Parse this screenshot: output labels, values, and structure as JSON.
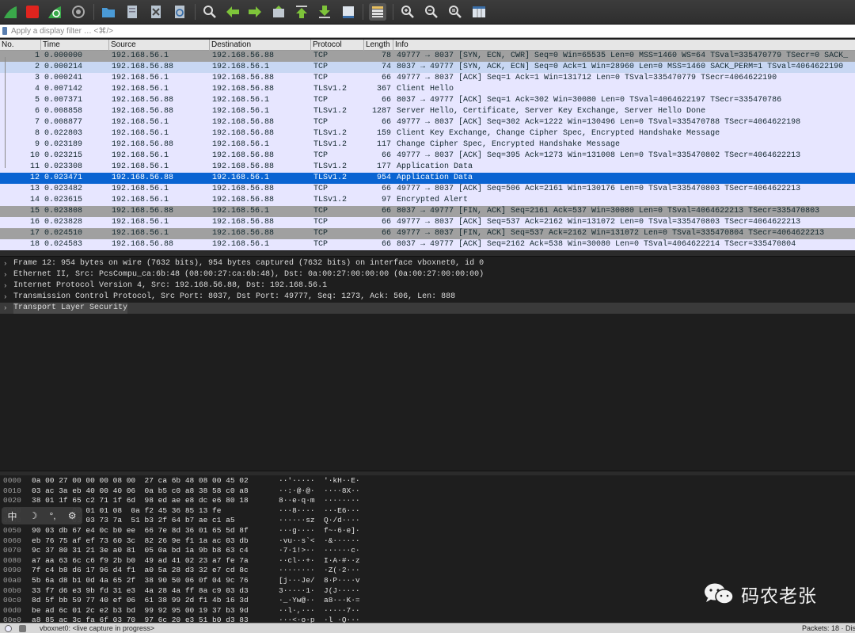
{
  "filter": {
    "placeholder": "Apply a display filter … <⌘/>"
  },
  "columns": {
    "no": "No.",
    "time": "Time",
    "source": "Source",
    "destination": "Destination",
    "protocol": "Protocol",
    "length": "Length",
    "info": "Info"
  },
  "packets": [
    {
      "no": "1",
      "time": "0.000000",
      "src": "192.168.56.1",
      "dst": "192.168.56.88",
      "proto": "TCP",
      "len": "78",
      "info": "49777 → 8037 [SYN, ECN, CWR] Seq=0 Win=65535 Len=0 MSS=1460 WS=64 TSval=335470779 TSecr=0 SACK_",
      "style": "gray"
    },
    {
      "no": "2",
      "time": "0.000214",
      "src": "192.168.56.88",
      "dst": "192.168.56.1",
      "proto": "TCP",
      "len": "74",
      "info": "8037 → 49777 [SYN, ACK, ECN] Seq=0 Ack=1 Win=28960 Len=0 MSS=1460 SACK_PERM=1 TSval=4064622190",
      "style": "lightblue"
    },
    {
      "no": "3",
      "time": "0.000241",
      "src": "192.168.56.1",
      "dst": "192.168.56.88",
      "proto": "TCP",
      "len": "66",
      "info": "49777 → 8037 [ACK] Seq=1 Ack=1 Win=131712 Len=0 TSval=335470779 TSecr=4064622190",
      "style": "lavender"
    },
    {
      "no": "4",
      "time": "0.007142",
      "src": "192.168.56.1",
      "dst": "192.168.56.88",
      "proto": "TLSv1.2",
      "len": "367",
      "info": "Client Hello",
      "style": "lavender"
    },
    {
      "no": "5",
      "time": "0.007371",
      "src": "192.168.56.88",
      "dst": "192.168.56.1",
      "proto": "TCP",
      "len": "66",
      "info": "8037 → 49777 [ACK] Seq=1 Ack=302 Win=30080 Len=0 TSval=4064622197 TSecr=335470786",
      "style": "lavender"
    },
    {
      "no": "6",
      "time": "0.008858",
      "src": "192.168.56.88",
      "dst": "192.168.56.1",
      "proto": "TLSv1.2",
      "len": "1287",
      "info": "Server Hello, Certificate, Server Key Exchange, Server Hello Done",
      "style": "lavender"
    },
    {
      "no": "7",
      "time": "0.008877",
      "src": "192.168.56.1",
      "dst": "192.168.56.88",
      "proto": "TCP",
      "len": "66",
      "info": "49777 → 8037 [ACK] Seq=302 Ack=1222 Win=130496 Len=0 TSval=335470788 TSecr=4064622198",
      "style": "lavender"
    },
    {
      "no": "8",
      "time": "0.022803",
      "src": "192.168.56.1",
      "dst": "192.168.56.88",
      "proto": "TLSv1.2",
      "len": "159",
      "info": "Client Key Exchange, Change Cipher Spec, Encrypted Handshake Message",
      "style": "lavender"
    },
    {
      "no": "9",
      "time": "0.023189",
      "src": "192.168.56.88",
      "dst": "192.168.56.1",
      "proto": "TLSv1.2",
      "len": "117",
      "info": "Change Cipher Spec, Encrypted Handshake Message",
      "style": "lavender"
    },
    {
      "no": "10",
      "time": "0.023215",
      "src": "192.168.56.1",
      "dst": "192.168.56.88",
      "proto": "TCP",
      "len": "66",
      "info": "49777 → 8037 [ACK] Seq=395 Ack=1273 Win=131008 Len=0 TSval=335470802 TSecr=4064622213",
      "style": "lavender"
    },
    {
      "no": "11",
      "time": "0.023308",
      "src": "192.168.56.1",
      "dst": "192.168.56.88",
      "proto": "TLSv1.2",
      "len": "177",
      "info": "Application Data",
      "style": "lavender"
    },
    {
      "no": "12",
      "time": "0.023471",
      "src": "192.168.56.88",
      "dst": "192.168.56.1",
      "proto": "TLSv1.2",
      "len": "954",
      "info": "Application Data",
      "style": "selected"
    },
    {
      "no": "13",
      "time": "0.023482",
      "src": "192.168.56.1",
      "dst": "192.168.56.88",
      "proto": "TCP",
      "len": "66",
      "info": "49777 → 8037 [ACK] Seq=506 Ack=2161 Win=130176 Len=0 TSval=335470803 TSecr=4064622213",
      "style": "lavender"
    },
    {
      "no": "14",
      "time": "0.023615",
      "src": "192.168.56.1",
      "dst": "192.168.56.88",
      "proto": "TLSv1.2",
      "len": "97",
      "info": "Encrypted Alert",
      "style": "lavender"
    },
    {
      "no": "15",
      "time": "0.023808",
      "src": "192.168.56.88",
      "dst": "192.168.56.1",
      "proto": "TCP",
      "len": "66",
      "info": "8037 → 49777 [FIN, ACK] Seq=2161 Ack=537 Win=30080 Len=0 TSval=4064622213 TSecr=335470803",
      "style": "gray"
    },
    {
      "no": "16",
      "time": "0.023828",
      "src": "192.168.56.1",
      "dst": "192.168.56.88",
      "proto": "TCP",
      "len": "66",
      "info": "49777 → 8037 [ACK] Seq=537 Ack=2162 Win=131072 Len=0 TSval=335470803 TSecr=4064622213",
      "style": "lavender"
    },
    {
      "no": "17",
      "time": "0.024510",
      "src": "192.168.56.1",
      "dst": "192.168.56.88",
      "proto": "TCP",
      "len": "66",
      "info": "49777 → 8037 [FIN, ACK] Seq=537 Ack=2162 Win=131072 Len=0 TSval=335470804 TSecr=4064622213",
      "style": "gray"
    },
    {
      "no": "18",
      "time": "0.024583",
      "src": "192.168.56.88",
      "dst": "192.168.56.1",
      "proto": "TCP",
      "len": "66",
      "info": "8037 → 49777 [ACK] Seq=2162 Ack=538 Win=30080 Len=0 TSval=4064622214 TSecr=335470804",
      "style": "lavender"
    }
  ],
  "row_colors": {
    "gray": "#a0a0a0",
    "lightblue": "#c8d7f3",
    "lavender": "#e7e6ff",
    "selected": "#0a64d2",
    "text": "#12272e",
    "selected_text": "#ffffff"
  },
  "details": [
    {
      "expanded": false,
      "text": "Frame 12: 954 bytes on wire (7632 bits), 954 bytes captured (7632 bits) on interface vboxnet0, id 0"
    },
    {
      "expanded": false,
      "text": "Ethernet II, Src: PcsCompu_ca:6b:48 (08:00:27:ca:6b:48), Dst: 0a:00:27:00:00:00 (0a:00:27:00:00:00)"
    },
    {
      "expanded": false,
      "text": "Internet Protocol Version 4, Src: 192.168.56.88, Dst: 192.168.56.1"
    },
    {
      "expanded": false,
      "text": "Transmission Control Protocol, Src Port: 8037, Dst Port: 49777, Seq: 1273, Ack: 506, Len: 888"
    },
    {
      "expanded": false,
      "text": "Transport Layer Security",
      "highlighted": true
    }
  ],
  "hex": [
    {
      "off": "0000",
      "hex": "0a 00 27 00 00 00 08 00  27 ca 6b 48 08 00 45 02",
      "ascii": "··'·····  '·kH··E·"
    },
    {
      "off": "0010",
      "hex": "03 ac 3a eb 40 00 40 06  0a b5 c0 a8 38 58 c0 a8",
      "ascii": "··:·@·@·  ····8X··"
    },
    {
      "off": "0020",
      "hex": "38 01 1f 65 c2 71 1f 6d  98 ed ae e8 dc e6 80 18",
      "ascii": "8··e·q·m  ········"
    },
    {
      "off": "0030",
      "hex": "         00 01 01 08  0a f2 45 36 85 13 fe",
      "ascii": "···8····  ···E6···"
    },
    {
      "off": "0040",
      "hex": "         03 03 73 7a  51 b3 2f 64 b7 ae c1 a5",
      "ascii": "······sz  Q·/d····"
    },
    {
      "off": "0050",
      "hex": "90 03 db 67 e4 0c b0 ee  66 7e 8d 36 01 65 5d 8f",
      "ascii": "···g····  f~·6·e]·"
    },
    {
      "off": "0060",
      "hex": "eb 76 75 af ef 73 60 3c  82 26 9e f1 1a ac 03 db",
      "ascii": "·vu··s`<  ·&······"
    },
    {
      "off": "0070",
      "hex": "9c 37 80 31 21 3e a0 81  05 0a bd 1a 9b b8 63 c4",
      "ascii": "·7·1!>··  ······c·"
    },
    {
      "off": "0080",
      "hex": "a7 aa 63 6c c6 f9 2b b0  49 ad 41 02 23 a7 fe 7a",
      "ascii": "··cl··+·  I·A·#··z"
    },
    {
      "off": "0090",
      "hex": "7f c4 b8 d6 17 96 d4 f1  a0 5a 28 d3 32 e7 cd 8c",
      "ascii": "········  ·Z(·2···"
    },
    {
      "off": "00a0",
      "hex": "5b 6a d8 b1 0d 4a 65 2f  38 90 50 06 0f 04 9c 76",
      "ascii": "[j···Je/  8·P····v"
    },
    {
      "off": "00b0",
      "hex": "33 f7 d6 e3 9b fd 31 e3  4a 28 4a ff 8a c9 03 d3",
      "ascii": "3·····1·  J(J·····"
    },
    {
      "off": "00c0",
      "hex": "8d 5f bb 59 77 40 ef 06  61 38 99 2d f1 4b 16 3d",
      "ascii": "·_·Yw@··  a8·-·K·="
    },
    {
      "off": "00d0",
      "hex": "be ad 6c 01 2c e2 b3 bd  99 92 95 00 19 37 b3 9d",
      "ascii": "··l·,···  ·····7··"
    },
    {
      "off": "00e0",
      "hex": "a8 85 ac 3c fa 6f 03 70  97 6c 20 e3 51 b0 d3 83",
      "ascii": "···<·o·p  ·l ·Q···"
    }
  ],
  "ime": {
    "lang": "中",
    "moon": "☽",
    "punct": "°,",
    "gear": "⚙"
  },
  "watermark": {
    "text": "码农老张"
  },
  "status": {
    "interface": "vboxnet0: <live capture in progress>",
    "packets": "Packets: 18 · Dis"
  },
  "toolbar": [
    "shark-fin-start-icon",
    "stop-capture-icon",
    "restart-capture-icon",
    "capture-options-icon",
    "open-file-icon",
    "save-file-icon",
    "close-file-icon",
    "reload-file-icon",
    "find-packet-icon",
    "go-back-icon",
    "go-forward-icon",
    "go-to-packet-icon",
    "go-first-icon",
    "go-last-icon",
    "autoscroll-icon",
    "colorize-icon",
    "zoom-in-icon",
    "zoom-out-icon",
    "zoom-normal-icon",
    "resize-columns-icon"
  ]
}
